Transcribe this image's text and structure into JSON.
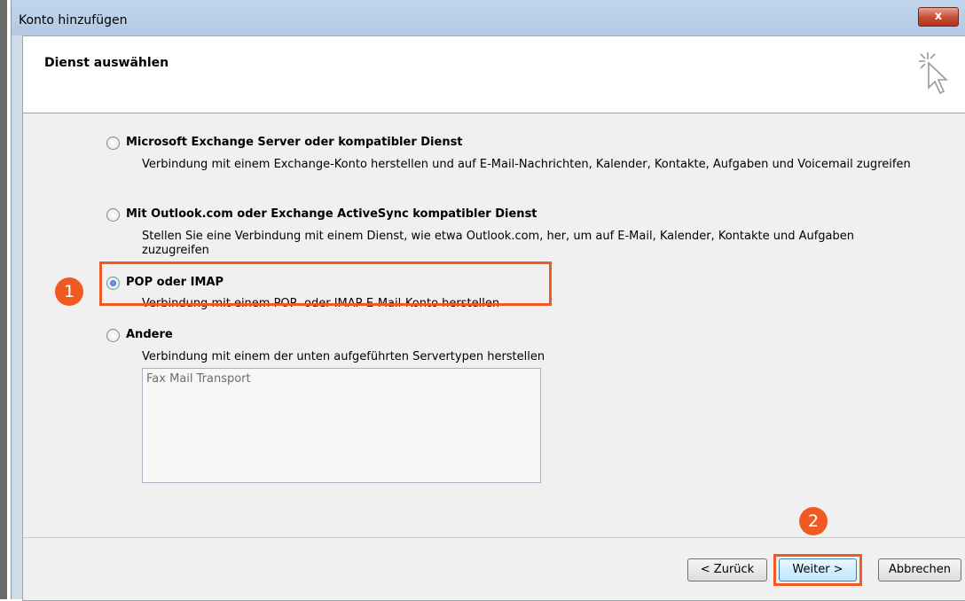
{
  "window": {
    "title": "Konto hinzufügen",
    "close_label": "x"
  },
  "header": {
    "title": "Dienst auswählen"
  },
  "options": [
    {
      "label": "Microsoft Exchange Server oder kompatibler Dienst",
      "description": "Verbindung mit einem Exchange-Konto herstellen und auf E-Mail-Nachrichten, Kalender, Kontakte, Aufgaben und Voicemail zugreifen",
      "selected": false
    },
    {
      "label": "Mit Outlook.com oder Exchange ActiveSync kompatibler Dienst",
      "description": "Stellen Sie eine Verbindung mit einem Dienst, wie etwa Outlook.com, her, um auf E-Mail, Kalender, Kontakte und Aufgaben zuzugreifen",
      "selected": false
    },
    {
      "label": "POP oder IMAP",
      "description": "Verbindung mit einem POP- oder IMAP-E-Mail-Konto herstellen",
      "selected": true
    },
    {
      "label": "Andere",
      "description": "Verbindung mit einem der unten aufgeführten Servertypen herstellen",
      "selected": false
    }
  ],
  "server_types": [
    "Fax Mail Transport"
  ],
  "annotations": {
    "step1": "1",
    "step2": "2",
    "accent_color": "#f05a22"
  },
  "footer": {
    "back_label": "< Zurück",
    "next_label": "Weiter >",
    "cancel_label": "Abbrechen"
  }
}
